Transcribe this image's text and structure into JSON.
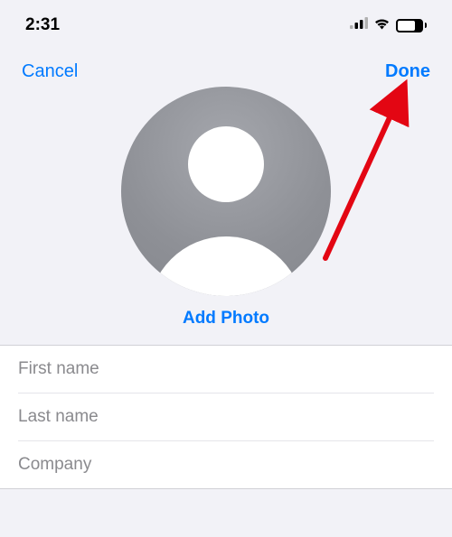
{
  "statusBar": {
    "time": "2:31",
    "battery": "68"
  },
  "nav": {
    "cancel": "Cancel",
    "done": "Done"
  },
  "photo": {
    "addPhoto": "Add Photo"
  },
  "fields": {
    "firstName": {
      "placeholder": "First name",
      "value": ""
    },
    "lastName": {
      "placeholder": "Last name",
      "value": ""
    },
    "company": {
      "placeholder": "Company",
      "value": ""
    }
  }
}
